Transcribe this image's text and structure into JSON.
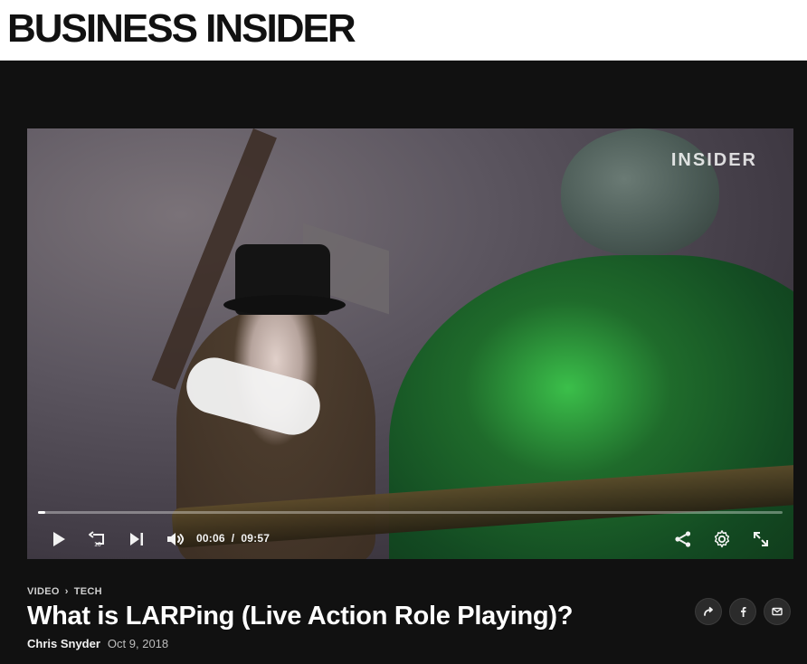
{
  "brand": {
    "logo_text": "BUSINESS INSIDER"
  },
  "video": {
    "watermark": "INSIDER",
    "current_time": "00:06",
    "duration": "09:57",
    "progress_fraction": 0.01,
    "rewind_label": "10"
  },
  "article": {
    "breadcrumb": {
      "section": "VIDEO",
      "subsection": "TECH"
    },
    "title": "What is LARPing (Live Action Role Playing)?",
    "author": "Chris Snyder",
    "date": "Oct 9, 2018"
  },
  "icons": {
    "play": "play-icon",
    "rewind10": "rewind-10-icon",
    "next": "skip-next-icon",
    "volume": "volume-icon",
    "share": "share-icon",
    "settings": "gear-icon",
    "fullscreen": "fullscreen-icon",
    "share_small": "share-arrow-icon",
    "facebook": "facebook-icon",
    "email": "email-icon"
  },
  "colors": {
    "page_bg": "#111111",
    "header_bg": "#ffffff"
  }
}
